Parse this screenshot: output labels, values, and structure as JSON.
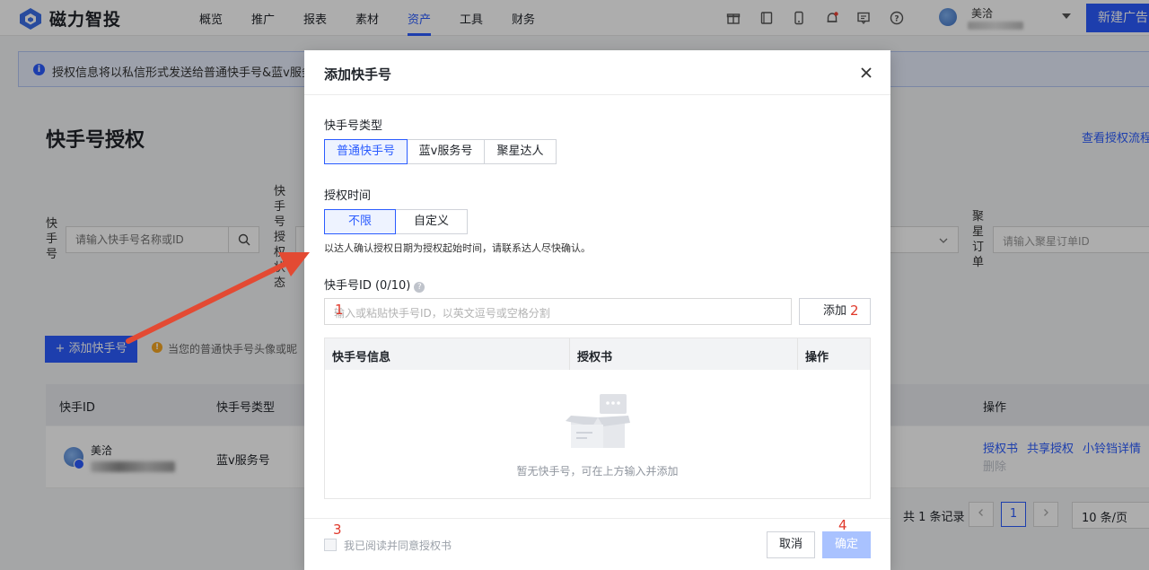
{
  "app": {
    "name": "磁力智投"
  },
  "nav": {
    "items": [
      "概览",
      "推广",
      "报表",
      "素材",
      "资产",
      "工具",
      "财务"
    ],
    "active": "资产"
  },
  "header": {
    "icons": [
      "gift-icon",
      "tablet-icon",
      "mobile-icon",
      "notification-bell-icon",
      "message-icon",
      "help-icon"
    ],
    "user_name": "美洽",
    "new_ad_label": "新建广告"
  },
  "page": {
    "info_text": "授权信息将以私信形式发送给普通快手号&蓝v服务",
    "title": "快手号授权",
    "view_flow_link": "查看授权流程",
    "filter_kuaishou_label": "快手号",
    "search_placeholder": "请输入快手号名称或ID",
    "filter_status_label": "快手号授权状态",
    "filter_order_label": "聚星订单",
    "order_placeholder": "请输入聚星订单ID",
    "add_button": "+ 添加快手号",
    "warn_text": "当您的普通快手号头像或昵",
    "table": {
      "headers": {
        "id": "快手ID",
        "type": "快手号类型",
        "actions": "操作"
      },
      "rows": [
        {
          "name": "美洽",
          "type": "蓝v服务号",
          "actions": [
            "授权书",
            "共享授权",
            "小铃铛详情"
          ],
          "disabled_action": "删除"
        }
      ]
    },
    "pagination": {
      "total": "共 1 条记录",
      "current": "1",
      "page_size": "10 条/页"
    }
  },
  "modal": {
    "title": "添加快手号",
    "type_label": "快手号类型",
    "type_options": [
      "普通快手号",
      "蓝v服务号",
      "聚星达人"
    ],
    "type_selected": "普通快手号",
    "time_label": "授权时间",
    "time_options": [
      "不限",
      "自定义"
    ],
    "time_selected": "不限",
    "time_hint": "以达人确认授权日期为授权起始时间，请联系达人尽快确认。",
    "id_label": "快手号ID (0/10)",
    "id_placeholder": "输入或粘贴快手号ID，以英文逗号或空格分割",
    "add_label": "添加",
    "table_headers": {
      "info": "快手号信息",
      "book": "授权书",
      "action": "操作"
    },
    "empty_text": "暂无快手号，可在上方输入并添加",
    "agree_text": "我已阅读并同意授权书",
    "cancel_label": "取消",
    "confirm_label": "确定"
  },
  "annotations": {
    "n1": "1",
    "n2": "2",
    "n3": "3",
    "n4": "4",
    "color": "#e0392b"
  },
  "colors": {
    "primary": "#2b5cff",
    "disabled_primary": "#a9c2ff",
    "overlay": "rgba(0,0,0,0.32)"
  }
}
